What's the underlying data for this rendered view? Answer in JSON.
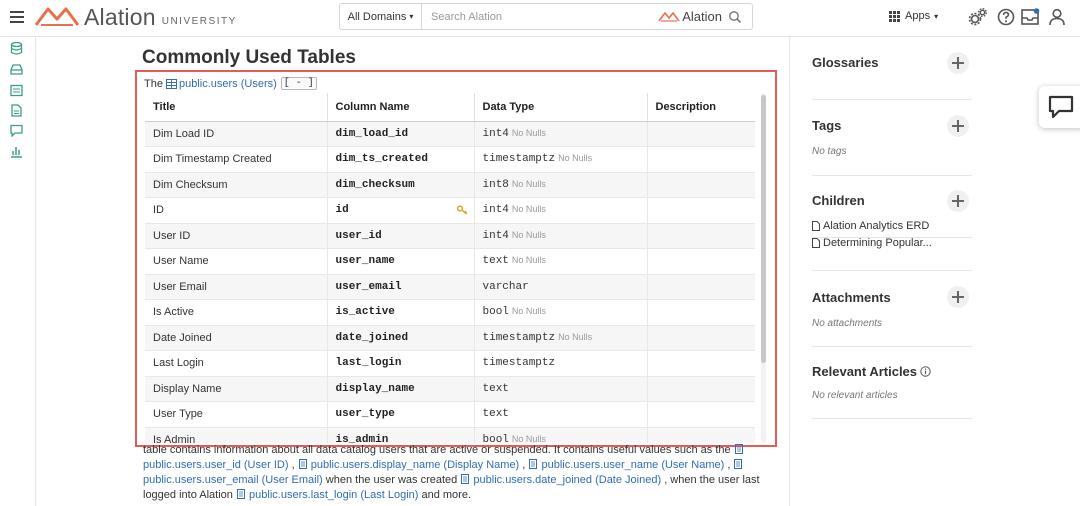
{
  "brand": {
    "name": "Alation",
    "sub": "UNIVERSITY",
    "accent": "#e8704c"
  },
  "search": {
    "domain": "All Domains",
    "placeholder": "Search Alation",
    "brand": "Alation"
  },
  "topnav": {
    "apps_label": "Apps",
    "icons": [
      "menu-icon",
      "settings-icon",
      "help-icon",
      "inbox-icon",
      "user-icon"
    ]
  },
  "leftrail": {
    "icons": [
      "database-icon",
      "storage-icon",
      "catalog-icon",
      "document-icon",
      "conversation-icon",
      "analytics-icon"
    ]
  },
  "page": {
    "title": "Commonly Used Tables"
  },
  "embedded_table": {
    "caption_prefix": "The",
    "table_link": "public.users (Users)",
    "collapse_label": "[ - ]",
    "headers": [
      "Title",
      "Column Name",
      "Data Type",
      "Description"
    ],
    "rows": [
      {
        "title": "Dim Load ID",
        "column": "dim_load_id",
        "type": "int4",
        "nulls": "No Nulls",
        "key": false
      },
      {
        "title": "Dim Timestamp Created",
        "column": "dim_ts_created",
        "type": "timestamptz",
        "nulls": "No Nulls",
        "key": false
      },
      {
        "title": "Dim Checksum",
        "column": "dim_checksum",
        "type": "int8",
        "nulls": "No Nulls",
        "key": false
      },
      {
        "title": "ID",
        "column": "id",
        "type": "int4",
        "nulls": "No Nulls",
        "key": true
      },
      {
        "title": "User ID",
        "column": "user_id",
        "type": "int4",
        "nulls": "No Nulls",
        "key": false
      },
      {
        "title": "User Name",
        "column": "user_name",
        "type": "text",
        "nulls": "No Nulls",
        "key": false
      },
      {
        "title": "User Email",
        "column": "user_email",
        "type": "varchar",
        "nulls": "",
        "key": false
      },
      {
        "title": "Is Active",
        "column": "is_active",
        "type": "bool",
        "nulls": "No Nulls",
        "key": false
      },
      {
        "title": "Date Joined",
        "column": "date_joined",
        "type": "timestamptz",
        "nulls": "No Nulls",
        "key": false
      },
      {
        "title": "Last Login",
        "column": "last_login",
        "type": "timestamptz",
        "nulls": "",
        "key": false
      },
      {
        "title": "Display Name",
        "column": "display_name",
        "type": "text",
        "nulls": "",
        "key": false
      },
      {
        "title": "User Type",
        "column": "user_type",
        "type": "text",
        "nulls": "",
        "key": false
      },
      {
        "title": "Is Admin",
        "column": "is_admin",
        "type": "bool",
        "nulls": "No Nulls",
        "key": false
      }
    ]
  },
  "description": {
    "t1": "table contains information about all data catalog users that are active or suspended.  It contains useful values such as the",
    "l1": "public.users.user_id (User ID)",
    "s1": ",",
    "l2": "public.users.display_name (Display Name)",
    "s2": ",",
    "l3": "public.users.user_name (User Name)",
    "s3": ",",
    "l4": "public.users.user_email (User Email)",
    "t2": "when the user was created",
    "l5": "public.users.date_joined (Date Joined)",
    "t3": ", when the user last logged into Alation",
    "l6": "public.users.last_login (Last Login)",
    "t4": "and more."
  },
  "rightpanel": {
    "glossaries": {
      "title": "Glossaries"
    },
    "tags": {
      "title": "Tags",
      "empty": "No tags"
    },
    "children": {
      "title": "Children",
      "items": [
        "Alation Analytics ERD",
        "Determining Popular..."
      ]
    },
    "attachments": {
      "title": "Attachments",
      "empty": "No attachments"
    },
    "articles": {
      "title": "Relevant Articles",
      "empty": "No relevant articles"
    }
  },
  "colors": {
    "highlight": "#e45b57",
    "link": "#2f6db5",
    "accent": "#e8704c"
  }
}
